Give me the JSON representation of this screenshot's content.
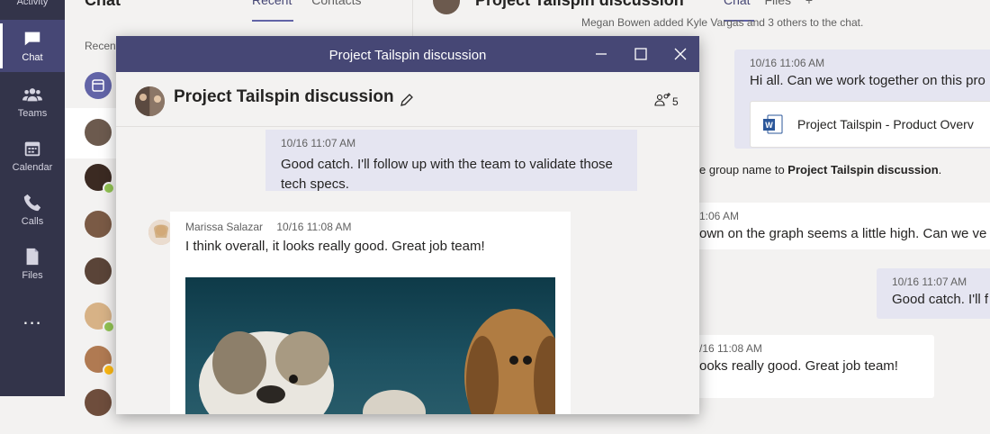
{
  "rail": {
    "top_label": "Activity",
    "items": [
      {
        "label": "Chat",
        "icon": "chat-icon",
        "active": true
      },
      {
        "label": "Teams",
        "icon": "teams-icon",
        "active": false
      },
      {
        "label": "Calendar",
        "icon": "calendar-icon",
        "active": false
      },
      {
        "label": "Calls",
        "icon": "calls-icon",
        "active": false
      },
      {
        "label": "Files",
        "icon": "files-icon",
        "active": false
      }
    ],
    "more": "..."
  },
  "chat_list": {
    "title": "Chat",
    "tabs": [
      "Recent",
      "Contacts"
    ],
    "more": "⋮",
    "recent_label": "Recent"
  },
  "main": {
    "title": "Project Tailspin discussion",
    "tabs": [
      "Chat",
      "Files",
      "+"
    ],
    "system_top": "Megan Bowen added Kyle Vargas and 3 others to the chat.",
    "first_message": {
      "time": "10/16 11:06 AM",
      "text": "Hi all.  Can we work together on this pro"
    },
    "file_name": "Project Tailspin - Product Overv",
    "system_rename_prefix": "e group name to ",
    "system_rename_name": "Project Tailspin discussion",
    "system_rename_suffix": ".",
    "msg2": {
      "time": "1:06 AM",
      "text": "own on the graph seems a little high.  Can we ve"
    },
    "msg3": {
      "time": "10/16 11:07 AM",
      "text": "Good catch.  I'll f"
    },
    "msg4": {
      "time": "/16 11:08 AM",
      "text": "ooks really good.  Great job team!"
    }
  },
  "popout": {
    "window_title": "Project Tailspin discussion",
    "chat_title": "Project Tailspin discussion",
    "people_count": "5",
    "my_message": {
      "time": "10/16 11:07 AM",
      "text": "Good catch.  I'll follow up with the team to validate those tech specs."
    },
    "other_message": {
      "author": "Marissa Salazar",
      "time": "10/16 11:08 AM",
      "text": "I think overall, it looks really good.  Great job team!"
    }
  },
  "colors": {
    "rail": "#33344a",
    "accent": "#6264a7",
    "titlebar": "#464775",
    "my_bubble": "#e5e5f1",
    "presence_available": "#92c353",
    "presence_away": "#fdb913"
  }
}
